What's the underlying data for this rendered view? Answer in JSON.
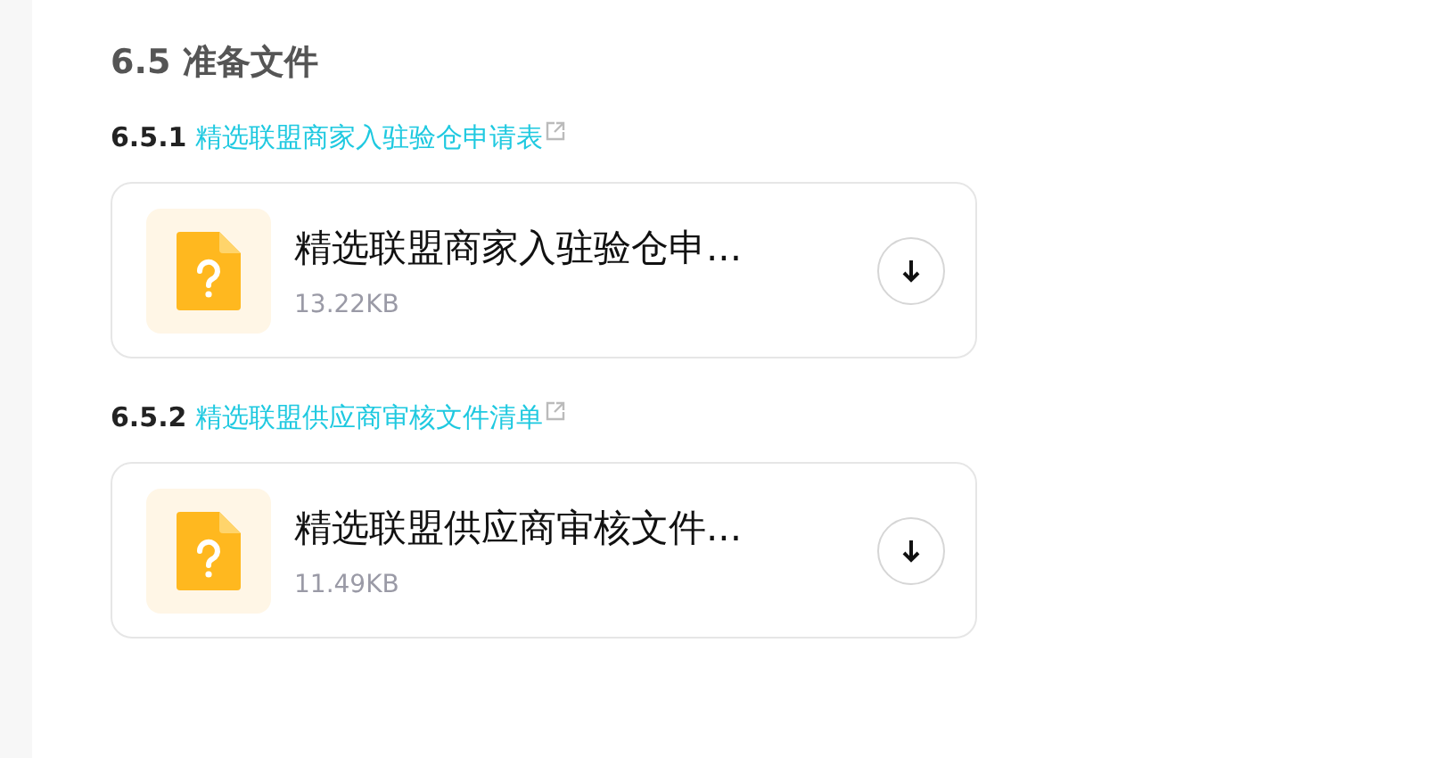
{
  "heading": "6.5 准备文件",
  "sections": [
    {
      "number": "6.5.1",
      "link": "精选联盟商家入驻验仓申请表",
      "file": {
        "name": "精选联盟商家入驻验仓申...",
        "size": "13.22KB"
      }
    },
    {
      "number": "6.5.2",
      "link": "精选联盟供应商审核文件清单",
      "file": {
        "name": "精选联盟供应商审核文件...",
        "size": "11.49KB"
      }
    }
  ]
}
